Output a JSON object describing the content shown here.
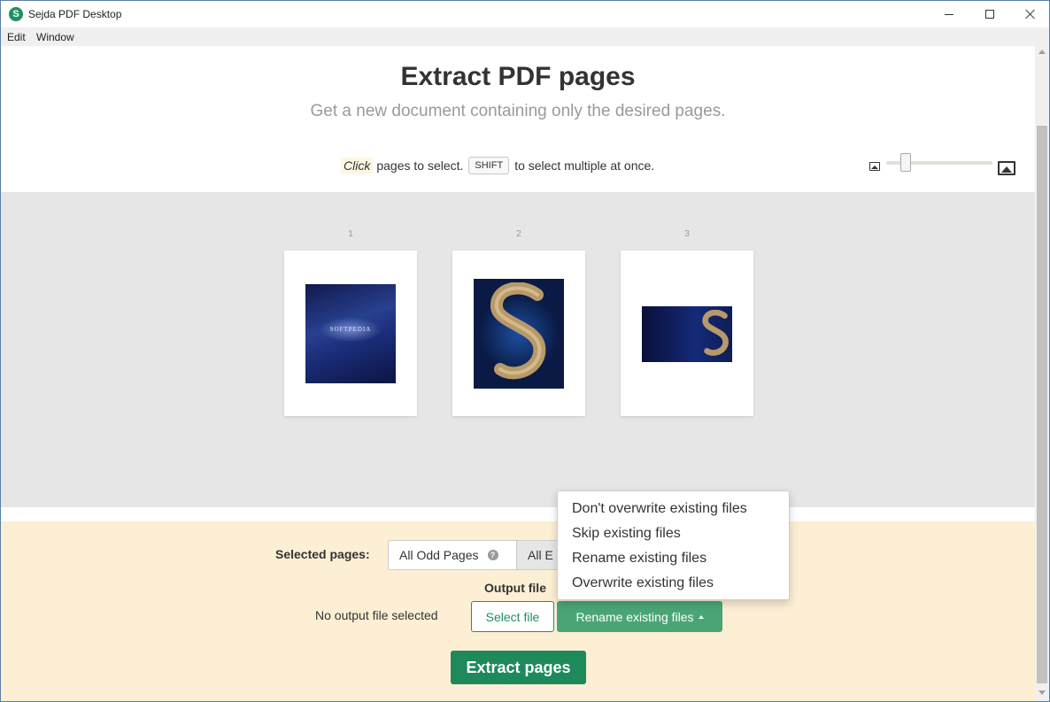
{
  "window": {
    "title": "Sejda PDF Desktop",
    "app_icon_letter": "S",
    "accent_color": "#21915f"
  },
  "menu": {
    "items": [
      "Edit",
      "Window"
    ]
  },
  "header": {
    "title": "Extract PDF pages",
    "subtitle": "Get a new document containing only the desired pages.",
    "hint_click": "Click",
    "hint_mid": "pages to select.",
    "hint_key": "SHIFT",
    "hint_end": "to select multiple at once.",
    "zoom_level": 0.15
  },
  "pages": [
    {
      "number": "1",
      "thumb_label": "SOFTPEDIA"
    },
    {
      "number": "2"
    },
    {
      "number": "3"
    }
  ],
  "bottom": {
    "selected_pages_label": "Selected pages:",
    "odd_pages_label": "All Odd Pages",
    "even_pages_label": "All E",
    "output_file_label": "Output file",
    "no_output_text": "No output file selected",
    "select_file_label": "Select file",
    "rename_button_label": "Rename existing files",
    "extract_label": "Extract pages"
  },
  "dropdown": {
    "options": [
      "Don't overwrite existing files",
      "Skip existing files",
      "Rename existing files",
      "Overwrite existing files"
    ]
  }
}
